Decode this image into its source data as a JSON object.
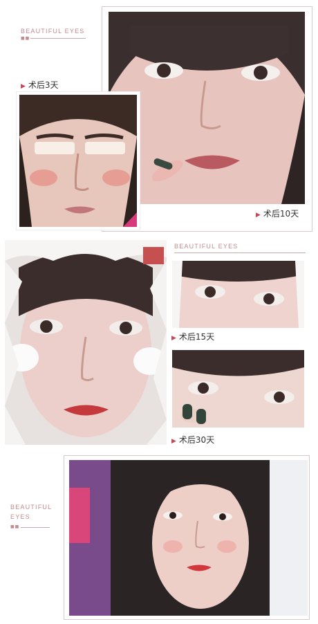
{
  "brand": {
    "line1": "BEAUTIFUL  EYES",
    "line2": "BEAUTIFUL  EYES",
    "line3a": "BEAUTIFUL",
    "line3b": "EYES",
    "dots": "■■"
  },
  "captions": {
    "day3": "术后3天",
    "day10": "术后10天",
    "day15": "术后15天",
    "day30": "术后30天"
  },
  "colors": {
    "accent": "#c04a58",
    "brand_text": "#c48a8f",
    "frame": "#d9c8c8"
  }
}
